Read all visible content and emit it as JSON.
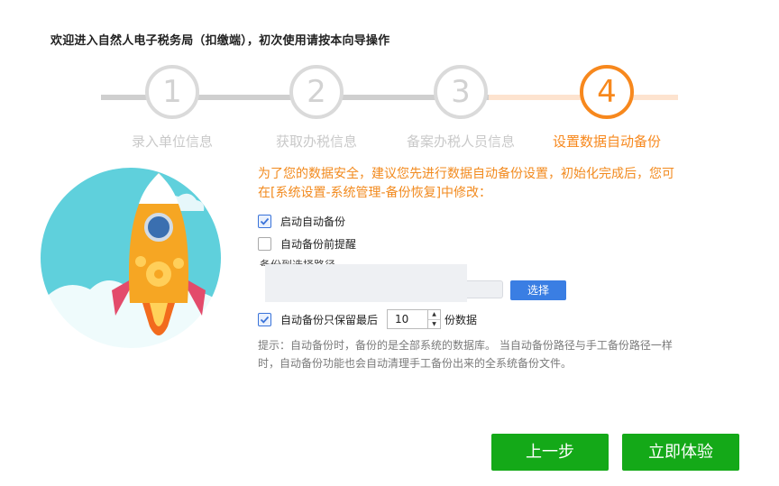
{
  "header": {
    "title": "欢迎进入自然人电子税务局（扣缴端），初次使用请按本向导操作"
  },
  "steps": [
    {
      "number": "1",
      "label": "录入单位信息",
      "state": "done"
    },
    {
      "number": "2",
      "label": "获取办税信息",
      "state": "done"
    },
    {
      "number": "3",
      "label": "备案办税人员信息",
      "state": "done"
    },
    {
      "number": "4",
      "label": "设置数据自动备份",
      "state": "active"
    }
  ],
  "colors": {
    "accent": "#f7881d",
    "primary_button": "#14a918",
    "select_button": "#3a7ee3"
  },
  "backup": {
    "intro": "为了您的数据安全，建议您先进行数据自动备份设置，初始化完成后，您可在[系统设置-系统管理-备份恢复]中修改：",
    "auto_backup_label": "启动自动备份",
    "auto_backup_checked": true,
    "remind_label": "自动备份前提醒",
    "remind_checked": false,
    "path_label": "备份到选择路径",
    "choose_button": "选择",
    "keep_prefix": "自动备份只保留最后",
    "keep_checked": true,
    "keep_value": "10",
    "keep_suffix": "份数据",
    "hint": "提示：自动备份时，备份的是全部系统的数据库。 当自动备份路径与手工备份路径一样时，自动备份功能也会自动清理手工备份出来的全系统备份文件。"
  },
  "footer": {
    "prev_label": "上一步",
    "next_label": "立即体验"
  }
}
